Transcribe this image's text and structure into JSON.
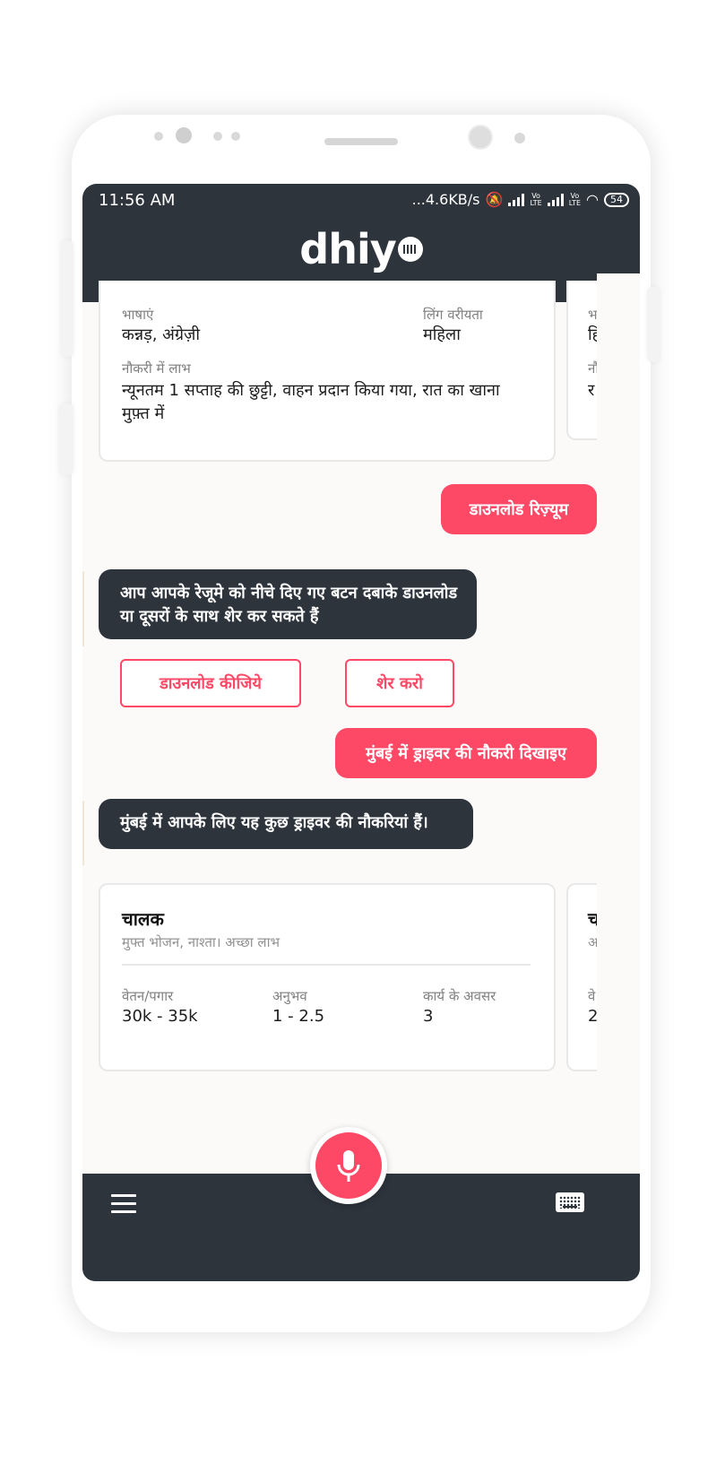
{
  "status_bar": {
    "time": "11:56 AM",
    "net_speed": "...4.6KB/s",
    "battery": "54",
    "volte": "Vo LTE"
  },
  "app": {
    "logo_text": "dhiy"
  },
  "profile_card": {
    "languages_label": "भाषाएं",
    "languages_value": "कन्नड़, अंग्रेज़ी",
    "gender_label": "लिंग वरीयता",
    "gender_value": "महिला",
    "benefits_label": "नौकरी में लाभ",
    "benefits_value": "न्यूनतम 1 सप्ताह की छुट्टी, वाहन प्रदान किया गया, रात का खाना मुफ़्त में",
    "peek_line1": "भ",
    "peek_line2": "हि",
    "peek_line3": "नौ",
    "peek_line4": "र"
  },
  "chat": {
    "user_msg_1": "डाउनलोड रिज़्यूम",
    "bot_msg_1": "आप आपके रेजूमे  को नीचे दिए गए बटन दबाके डाउनलोड या दूसरों के साथ शेर कर सकते हैं",
    "download_button": "डाउनलोड कीजिये",
    "share_button": "शेर करो",
    "user_msg_2": "मुंबई में ड्राइवर की नौकरी दिखाइए",
    "bot_msg_2": "मुंबई में आपके लिए यह कुछ ड्राइवर की नौकरियां हैं।"
  },
  "job_card": {
    "title": "चालक",
    "subtitle": "मुफ्त भोजन, नाश्ता। अच्छा लाभ",
    "salary_label": "वेतन/पगार",
    "salary_value": "30k - 35k",
    "experience_label": "अनुभव",
    "experience_value": "1 - 2.5",
    "openings_label": "कार्य के अवसर",
    "openings_value": "3",
    "peek_title": "च",
    "peek_sub": "अ",
    "peek_label": "वे",
    "peek_value": "2"
  },
  "colors": {
    "accent": "#fd4866",
    "dark": "#2d343c",
    "background": "#fbfaf8"
  },
  "icons": [
    "menu-icon",
    "microphone-icon",
    "keyboard-icon",
    "wifi-icon",
    "mute-icon",
    "signal-icon",
    "battery-icon"
  ]
}
